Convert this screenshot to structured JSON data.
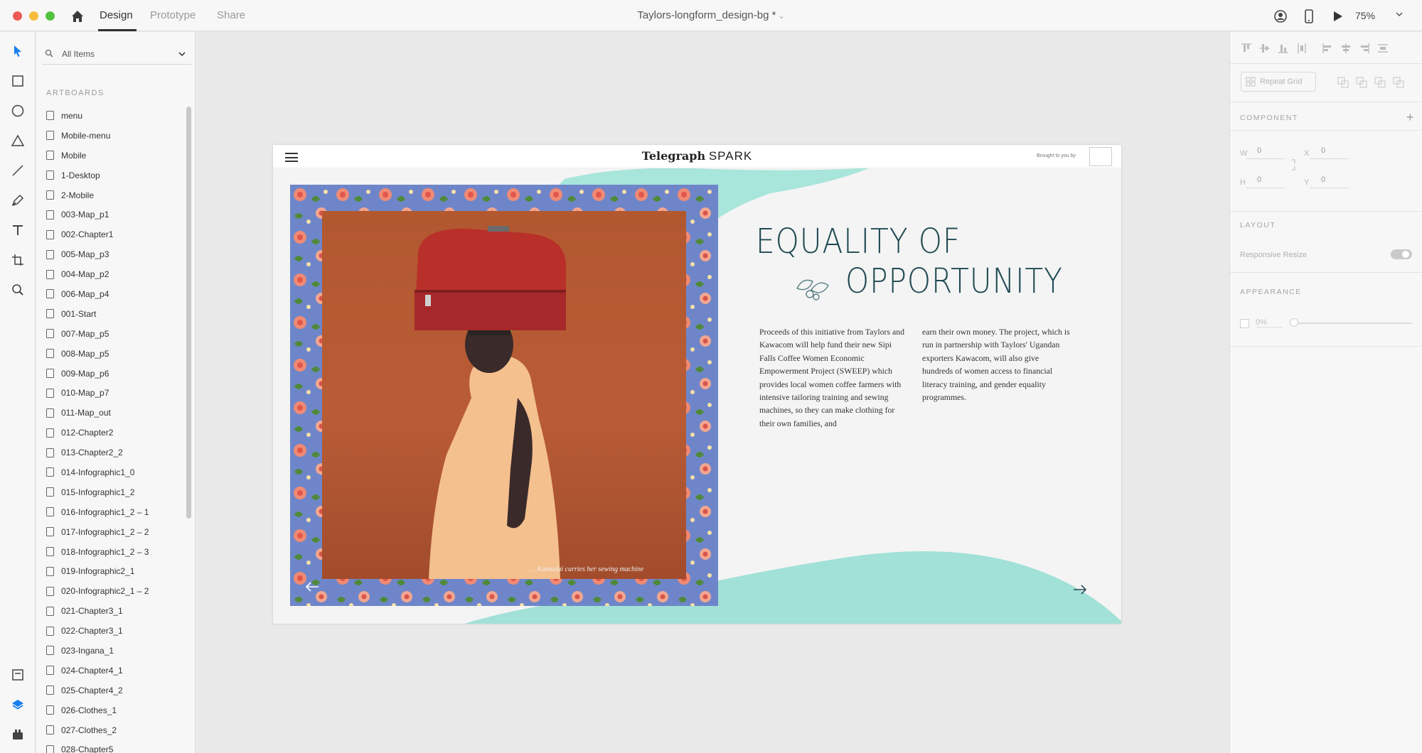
{
  "titlebar": {
    "tabs": [
      {
        "label": "Design",
        "active": true
      },
      {
        "label": "Prototype",
        "active": false
      },
      {
        "label": "Share",
        "active": false
      }
    ],
    "document_title": "Taylors-longform_design-bg *",
    "zoom": "75%",
    "icons": [
      "home-icon",
      "user-icon",
      "device-preview-icon",
      "play-icon",
      "chevron-down-icon"
    ]
  },
  "tools": [
    "select-tool-icon",
    "rectangle-tool-icon",
    "ellipse-tool-icon",
    "triangle-tool-icon",
    "line-tool-icon",
    "pen-tool-icon",
    "text-tool-icon",
    "artboard-tool-icon",
    "zoom-tool-icon",
    "assets-icon",
    "layers-icon",
    "plugins-icon"
  ],
  "layers": {
    "search_value": "All Items",
    "section_label": "ARTBOARDS",
    "artboards": [
      "menu",
      "Mobile-menu",
      "Mobile",
      "1-Desktop",
      "2-Mobile",
      "003-Map_p1",
      "002-Chapter1",
      "005-Map_p3",
      "004-Map_p2",
      "006-Map_p4",
      "001-Start",
      "007-Map_p5",
      "008-Map_p5",
      "009-Map_p6",
      "010-Map_p7",
      "011-Map_out",
      "012-Chapter2",
      "013-Chapter2_2",
      "014-Infographic1_0",
      "015-Infographic1_2",
      "016-Infographic1_2 – 1",
      "017-Infographic1_2 – 2",
      "018-Infographic1_2 – 3",
      "019-Infographic2_1",
      "020-Infographic2_1 – 2",
      "021-Chapter3_1",
      "022-Chapter3_1",
      "023-Ingana_1",
      "024-Chapter4_1",
      "025-Chapter4_2",
      "026-Clothes_1",
      "027-Clothes_2",
      "028-Chapter5"
    ]
  },
  "artboard": {
    "brand_left": "Telegraph",
    "brand_right": "SPARK",
    "brought_by": "Brought to you by",
    "headline_line1": "EQUALITY OF",
    "headline_line2": "OPPORTUNITY",
    "body_col1": "Proceeds of this initiative from Taylors and Kawacom will help fund their new Sipi Falls Coffee Women Economic Empowerment Project (SWEEP) which provides local women coffee farmers with intensive tailoring training and sewing machines, so they can make clothing for their own families, and",
    "body_col2": "earn their own money. The project, which is run in partnership with Taylors' Ugandan exporters Kawacom, will also give hundreds of women access to financial literacy training, and gender equality programmes.",
    "caption": "… Kamudai carries her sewing machine",
    "accent_color": "#1f4a52",
    "wash_color": "#7fd9cb"
  },
  "inspector": {
    "repeat_grid_label": "Repeat Grid",
    "component_label": "COMPONENT",
    "w_label": "W",
    "w_value": "0",
    "h_label": "H",
    "h_value": "0",
    "x_label": "X",
    "x_value": "0",
    "y_label": "Y",
    "y_value": "0",
    "layout_label": "LAYOUT",
    "responsive_resize_label": "Responsive Resize",
    "appearance_label": "APPEARANCE",
    "opacity_value": "0%",
    "opacity_fraction": 0
  }
}
